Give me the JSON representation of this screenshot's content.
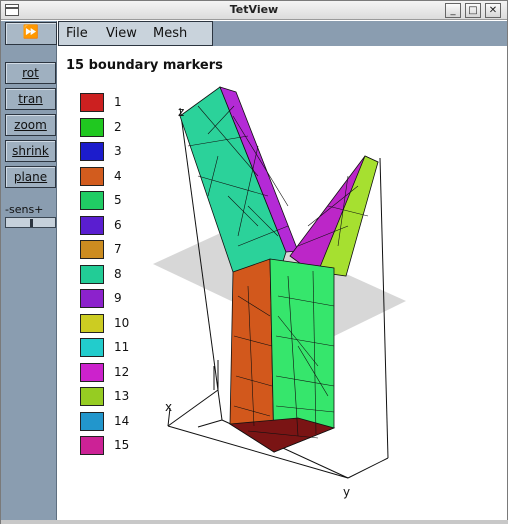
{
  "window": {
    "title": "TetView"
  },
  "window_buttons": [
    "_",
    "□",
    "✕"
  ],
  "toolbar": {
    "ff_label": "⏩",
    "buttons": [
      "rot",
      "tran",
      "zoom",
      "shrink",
      "plane"
    ],
    "sens_label": "-sens+",
    "sens_value": 0.5
  },
  "menubar": {
    "items": [
      "File",
      "View",
      "Mesh"
    ]
  },
  "main": {
    "heading": "15 boundary markers"
  },
  "legend": [
    {
      "label": "1",
      "color": "#cc2020"
    },
    {
      "label": "2",
      "color": "#20c820"
    },
    {
      "label": "3",
      "color": "#1c1ccc"
    },
    {
      "label": "4",
      "color": "#d25c1e"
    },
    {
      "label": "5",
      "color": "#20cc64"
    },
    {
      "label": "6",
      "color": "#5a1ed0"
    },
    {
      "label": "7",
      "color": "#cc8c20"
    },
    {
      "label": "8",
      "color": "#22cc96"
    },
    {
      "label": "9",
      "color": "#8c22cc"
    },
    {
      "label": "10",
      "color": "#cccc22"
    },
    {
      "label": "11",
      "color": "#22cccc"
    },
    {
      "label": "12",
      "color": "#cc22cc"
    },
    {
      "label": "13",
      "color": "#96cc22"
    },
    {
      "label": "14",
      "color": "#2296cc"
    },
    {
      "label": "15",
      "color": "#cc2296"
    }
  ],
  "axes": {
    "z": "z",
    "x": "x",
    "y": "y"
  }
}
